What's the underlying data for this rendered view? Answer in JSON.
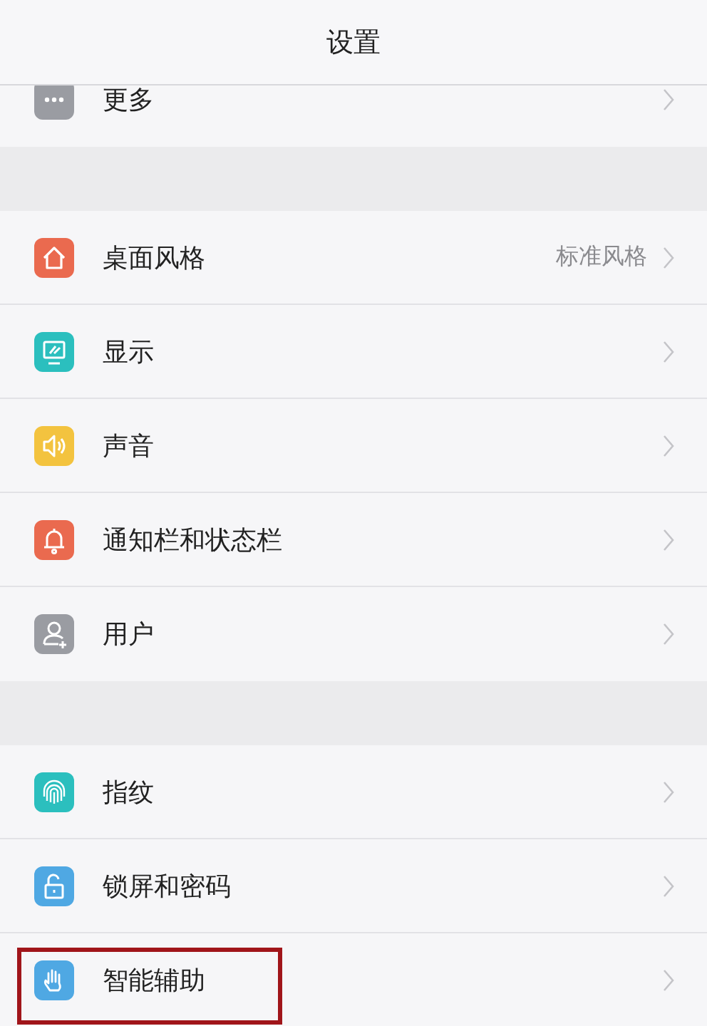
{
  "header": {
    "title": "设置"
  },
  "sections": [
    {
      "items": [
        {
          "label": "更多",
          "kind": "dots",
          "color": "#9a9ca2",
          "highlighted": false
        }
      ]
    },
    {
      "items": [
        {
          "label": "桌面风格",
          "value": "标准风格",
          "kind": "house",
          "color": "#ea6a4f",
          "highlighted": false
        },
        {
          "label": "显示",
          "kind": "monitor",
          "color": "#2bbfbe",
          "highlighted": false
        },
        {
          "label": "声音",
          "kind": "speaker",
          "color": "#f3c33f",
          "highlighted": false
        },
        {
          "label": "通知栏和状态栏",
          "kind": "bell",
          "color": "#ea6a4f",
          "highlighted": false
        },
        {
          "label": "用户",
          "kind": "user",
          "color": "#9a9ca2",
          "highlighted": false
        }
      ]
    },
    {
      "items": [
        {
          "label": "指纹",
          "kind": "fingerprint",
          "color": "#2bbfbe",
          "highlighted": false
        },
        {
          "label": "锁屏和密码",
          "kind": "lock",
          "color": "#4fa8e3",
          "highlighted": false
        },
        {
          "label": "智能辅助",
          "kind": "hand",
          "color": "#4fa8e3",
          "highlighted": true
        }
      ]
    }
  ]
}
